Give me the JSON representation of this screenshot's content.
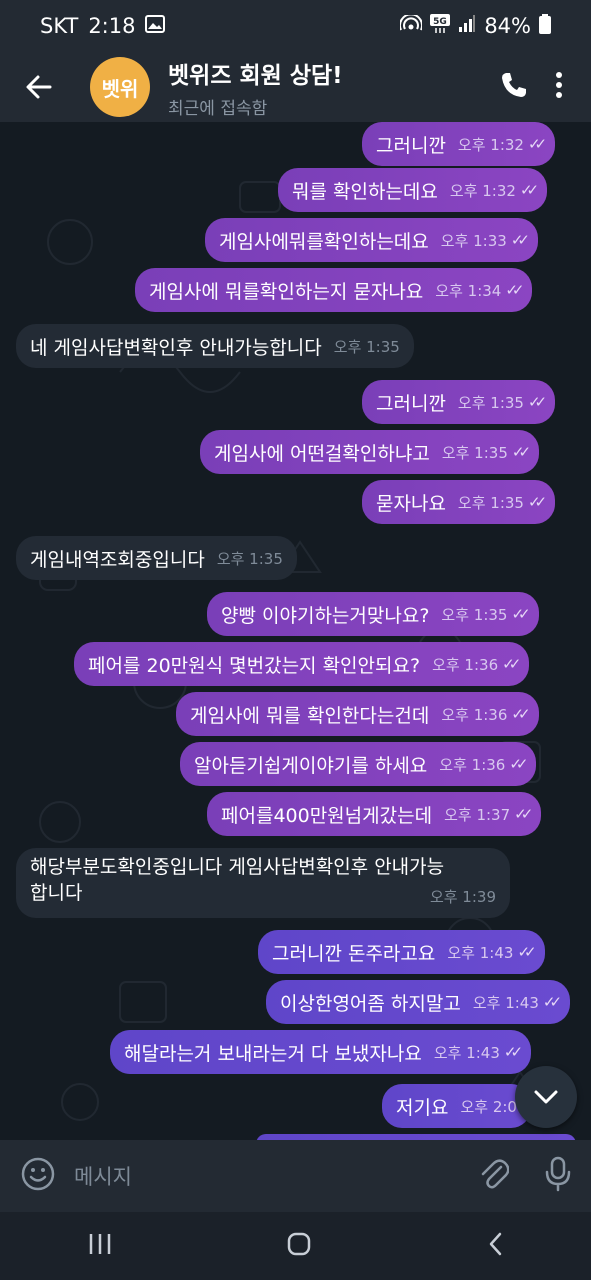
{
  "status_bar": {
    "carrier": "SKT",
    "time": "2:18",
    "battery": "84%"
  },
  "header": {
    "avatar_text": "벳위",
    "title": "벳위즈 회원 상담!",
    "subtitle": "최근에 접속함"
  },
  "messages": [
    {
      "dir": "out",
      "text": "그러니깐",
      "time": "오후 1:32"
    },
    {
      "dir": "out",
      "text": "뭐를 확인하는데요",
      "time": "오후 1:32"
    },
    {
      "dir": "out",
      "text": "게임사에뭐를확인하는데요",
      "time": "오후 1:33"
    },
    {
      "dir": "out",
      "text": "게임사에 뭐를확인하는지 묻자나요",
      "time": "오후 1:34"
    },
    {
      "dir": "in",
      "text": "네 게임사답변확인후 안내가능합니다",
      "time": "오후 1:35"
    },
    {
      "dir": "out",
      "text": "그러니깐",
      "time": "오후 1:35"
    },
    {
      "dir": "out",
      "text": "게임사에 어떤걸확인하냐고",
      "time": "오후 1:35"
    },
    {
      "dir": "out",
      "text": "묻자나요",
      "time": "오후 1:35"
    },
    {
      "dir": "in",
      "text": "게임내역조회중입니다",
      "time": "오후 1:35"
    },
    {
      "dir": "out",
      "text": "양빵 이야기하는거맞나요?",
      "time": "오후 1:35"
    },
    {
      "dir": "out",
      "text": "페어를 20만원식 몇번갔는지 확인안되요?",
      "time": "오후 1:36"
    },
    {
      "dir": "out",
      "text": "게임사에 뭐를 확인한다는건데",
      "time": "오후 1:36"
    },
    {
      "dir": "out",
      "text": "알아듣기쉽게이야기를 하세요",
      "time": "오후 1:36"
    },
    {
      "dir": "out",
      "text": "페어를400만원넘게갔는데",
      "time": "오후 1:37"
    },
    {
      "dir": "in",
      "text_line1": "해당부분도확인중입니다 게임사답변확인후 안내가능",
      "text_line2": "합니다",
      "time": "오후 1:39"
    },
    {
      "dir": "out",
      "text": "그러니깐 돈주라고요",
      "time": "오후 1:43"
    },
    {
      "dir": "out",
      "text": "이상한영어좀 하지말고",
      "time": "오후 1:43"
    },
    {
      "dir": "out",
      "text": "해달라는거 보내라는거 다 보냈자나요",
      "time": "오후 1:43"
    },
    {
      "dir": "out",
      "text": "저기요",
      "time": "오후 2:0"
    }
  ],
  "input": {
    "placeholder": "메시지"
  },
  "colors": {
    "out_bubble": "#8b45c2",
    "out_bubble_late": "#6a4bd0",
    "in_bubble": "#232b35",
    "bg": "#141b22",
    "avatar": "#f0b045"
  }
}
